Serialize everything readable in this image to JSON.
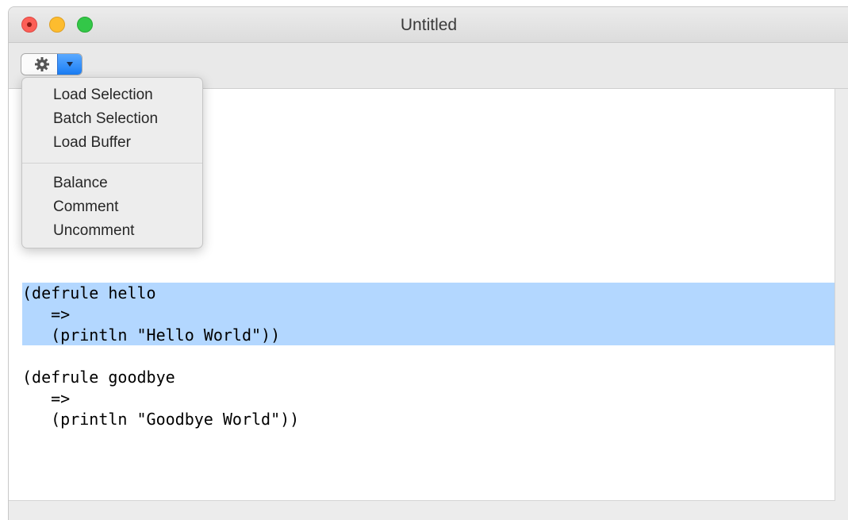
{
  "window": {
    "title": "Untitled"
  },
  "toolbar": {
    "action_icon": "gear-icon",
    "dropdown_icon": "triangle-down-icon"
  },
  "menu": {
    "group1": [
      "Load Selection",
      "Batch Selection",
      "Load Buffer"
    ],
    "group2": [
      "Balance",
      "Comment",
      "Uncomment"
    ]
  },
  "editor": {
    "lines": [
      "(defrule hello",
      "   =>",
      "   (println \"Hello World\"))",
      "",
      "(defrule goodbye",
      "   =>",
      "   (println \"Goodbye World\"))"
    ],
    "selection_color": "#b3d7ff"
  }
}
